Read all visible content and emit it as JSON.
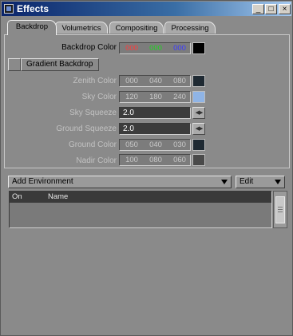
{
  "window": {
    "title": "Effects"
  },
  "tabs": [
    "Backdrop",
    "Volumetrics",
    "Compositing",
    "Processing"
  ],
  "backdrop": {
    "backdrop_color": {
      "label": "Backdrop Color",
      "r": "000",
      "g": "000",
      "b": "000",
      "swatch": "#000000",
      "r_color": "#ff3b3b",
      "g_color": "#22d222",
      "b_color": "#3a3aff"
    },
    "gradient_backdrop_label": "Gradient Backdrop",
    "zenith": {
      "label": "Zenith Color",
      "r": "000",
      "g": "040",
      "b": "080",
      "swatch": "#1f2a33"
    },
    "sky": {
      "label": "Sky Color",
      "r": "120",
      "g": "180",
      "b": "240",
      "swatch": "#8fb4e6"
    },
    "sky_squeeze": {
      "label": "Sky Squeeze",
      "value": "2.0"
    },
    "ground_squeeze": {
      "label": "Ground Squeeze",
      "value": "2.0"
    },
    "ground": {
      "label": "Ground Color",
      "r": "050",
      "g": "040",
      "b": "030",
      "swatch": "#1f2a33"
    },
    "nadir": {
      "label": "Nadir Color",
      "r": "100",
      "g": "080",
      "b": "060",
      "swatch": "#4a4a4a"
    }
  },
  "environment": {
    "add_label": "Add Environment",
    "edit_label": "Edit",
    "columns": [
      "On",
      "Name"
    ]
  },
  "icons": {
    "minimize": "minimize-icon",
    "maximize": "maximize-icon",
    "close": "close-icon",
    "spin": "spin-arrows-icon",
    "dropdown": "chevron-down-icon"
  }
}
